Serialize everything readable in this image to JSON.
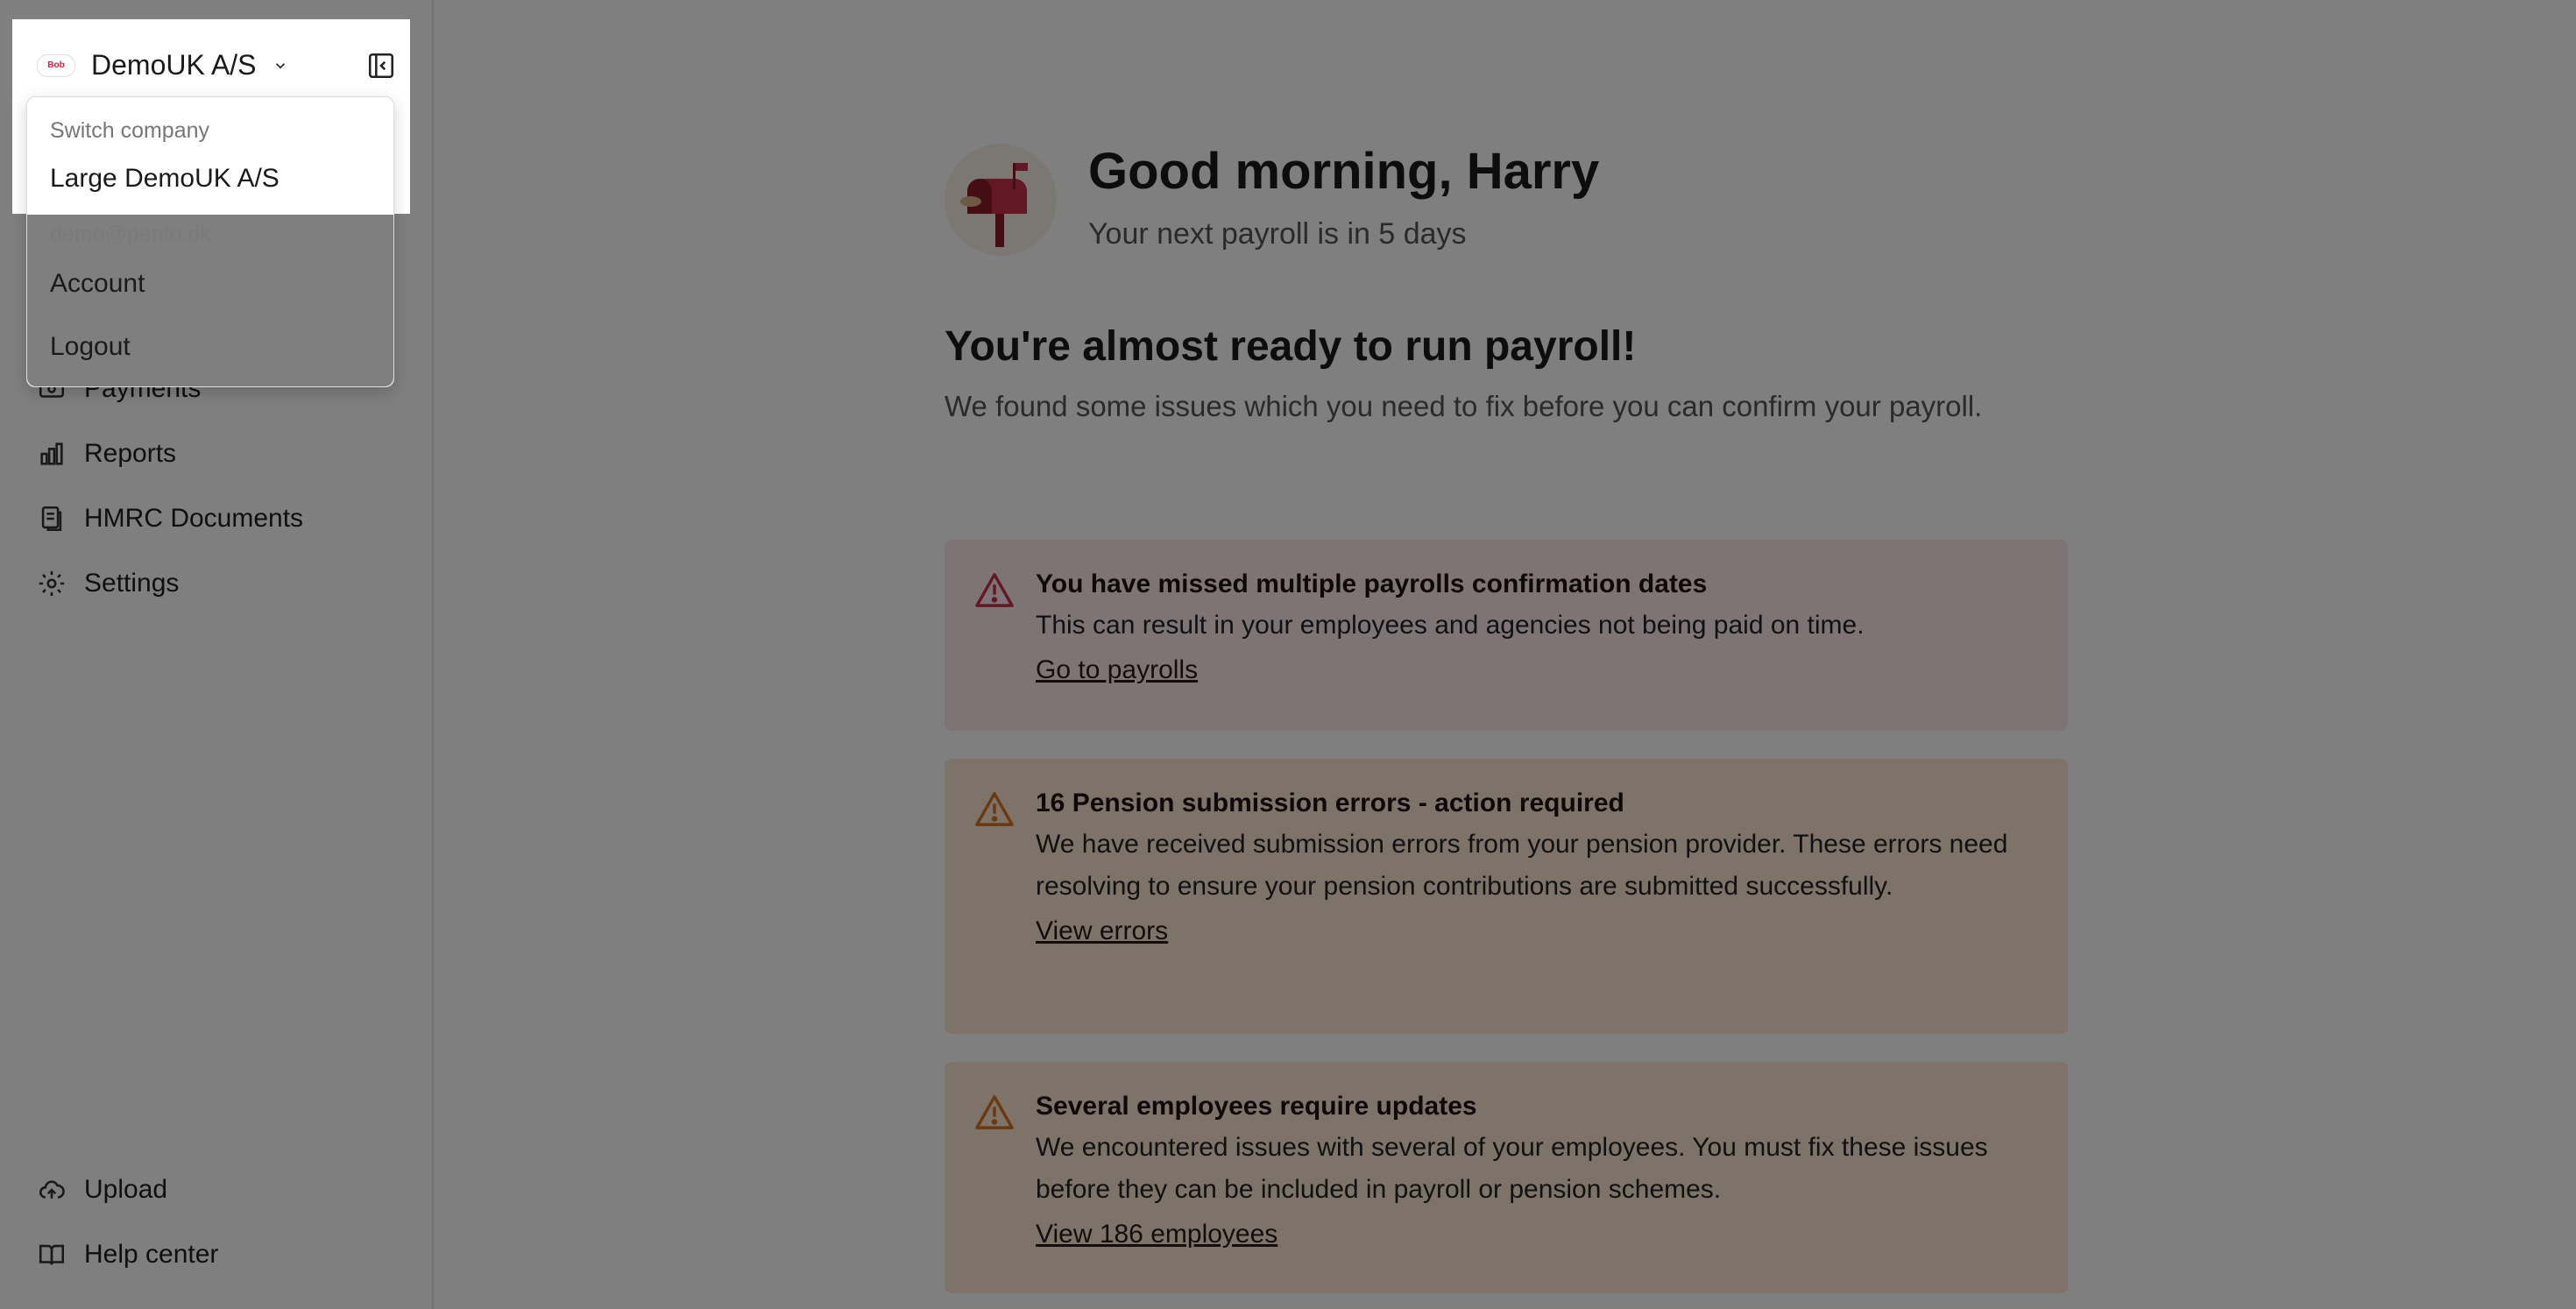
{
  "company": {
    "name": "DemoUK A/S",
    "logo_text": "Bob"
  },
  "dropdown": {
    "switch_label": "Switch company",
    "other_company": "Large DemoUK A/S",
    "email": "demo@pento.dk",
    "account": "Account",
    "logout": "Logout"
  },
  "sidebar": {
    "items": [
      {
        "label": "Payments",
        "icon": "payments-icon"
      },
      {
        "label": "Reports",
        "icon": "reports-icon"
      },
      {
        "label": "HMRC Documents",
        "icon": "documents-icon"
      },
      {
        "label": "Settings",
        "icon": "gear-icon"
      }
    ],
    "footer": [
      {
        "label": "Upload",
        "icon": "upload-cloud-icon"
      },
      {
        "label": "Help center",
        "icon": "book-icon"
      }
    ]
  },
  "greeting": {
    "title": "Good morning, Harry",
    "subtitle": "Your next payroll is in 5 days"
  },
  "status": {
    "title": "You're almost ready to run payroll!",
    "description": "We found some issues which you need to fix before you can confirm your payroll."
  },
  "alerts": [
    {
      "title": "You have missed multiple payrolls confirmation dates",
      "body": "This can result in your employees and agencies not being paid on time.",
      "link": "Go to payrolls",
      "severity": "error"
    },
    {
      "title": "16 Pension submission errors - action required",
      "body": "We have received submission errors from your pension provider. These errors need resolving to ensure your pension contributions are submitted successfully.",
      "link": "View errors",
      "severity": "warning"
    },
    {
      "title": "Several employees require updates",
      "body": "We encountered issues with several of your employees. You must fix these issues before they can be included in payroll or pension schemes.",
      "link": "View 186 employees",
      "severity": "warning"
    }
  ],
  "colors": {
    "error": "#c4314b",
    "warning": "#d4731f",
    "overlay": "rgba(0,0,0,0.5)"
  }
}
